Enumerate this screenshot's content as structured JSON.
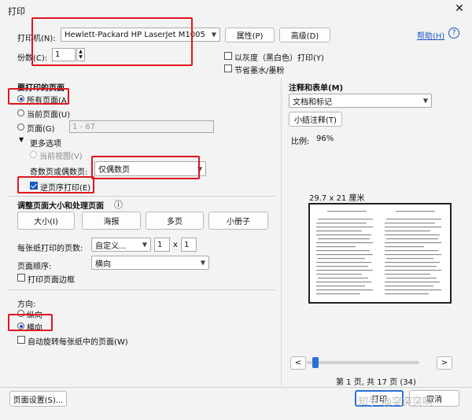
{
  "window": {
    "title": "打印",
    "close_glyph": "✕"
  },
  "printer": {
    "label": "打印机(N):",
    "selected": "Hewlett-Packard HP LaserJet M1005",
    "properties_button": "属性(P)",
    "advanced_button": "高级(D)",
    "help_link": "帮助(H)",
    "help_icon": "?",
    "copies_label": "份数(C):",
    "copies_value": "1",
    "grayscale_label": "以灰度（黑白色）打印(Y)",
    "save_ink_label": "节省墨水/墨粉"
  },
  "pages": {
    "heading": "要打印的页面",
    "all_label": "所有页面(A)",
    "current_label": "当前页面(U)",
    "range_label": "页面(G)",
    "range_placeholder": "1 - 67",
    "more_options_label": "更多选项",
    "current_view_label": "当前视图(V)",
    "odd_even_label": "奇数页或偶数页:",
    "odd_even_value": "仅偶数页",
    "reverse_label": "逆页序打印(E)"
  },
  "sizing": {
    "heading": "调整页面大小和处理页面",
    "info_icon": "ⓘ",
    "buttons": [
      "大小(I)",
      "海报",
      "多页",
      "小册子"
    ],
    "per_sheet_label": "每张纸打印的页数:",
    "per_sheet_value": "自定义...",
    "per_sheet_x": "1",
    "per_sheet_y": "1",
    "x_label": "x",
    "order_label": "页面顺序:",
    "order_value": "横向",
    "border_label": "打印页面边框"
  },
  "orientation": {
    "heading": "方向:",
    "portrait_label": "纵向",
    "landscape_label": "横向",
    "auto_rotate_label": "自动旋转每张纸中的页面(W)"
  },
  "comments": {
    "heading": "注释和表单(M)",
    "value": "文档和标记",
    "summarize_button": "小结注释(T)"
  },
  "preview": {
    "scale_label": "比例:",
    "scale_value": "96%",
    "paper_size": "29.7 x 21 厘米",
    "page_status": "第 1 页, 共 17 页 (34)",
    "prev_glyph": "<",
    "next_glyph": ">",
    "scroll_position": 0.05
  },
  "footer": {
    "page_setup_button": "页面设置(S)...",
    "print_button": "打印",
    "cancel_button": "取消",
    "watermark": "知乎 @突突突啊"
  },
  "colors": {
    "accent": "#1a56c4",
    "highlight": "#e0161f"
  }
}
